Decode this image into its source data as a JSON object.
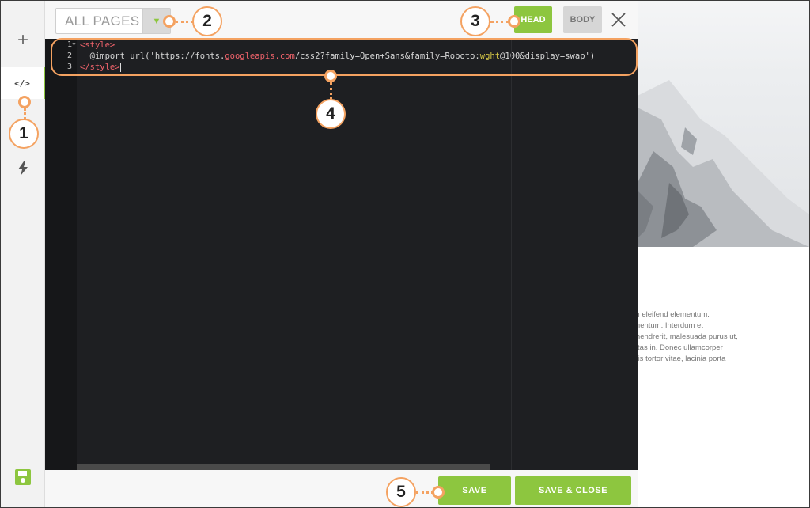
{
  "rail": {
    "add_icon": "plus-icon",
    "code_icon": "code-icon",
    "bolt_icon": "bolt-icon",
    "save_icon": "floppy-icon",
    "add_glyph": "+",
    "code_glyph": "</>"
  },
  "header": {
    "page_select_value": "ALL PAGES",
    "head_label": "HEAD",
    "body_label": "BODY",
    "close_icon": "close-icon"
  },
  "editor": {
    "line_numbers": [
      "1",
      "2",
      "3"
    ],
    "line1_tag": "<style>",
    "line2_prefix": "  @import url('https://fonts.",
    "line2_domain": "googleapis.com",
    "line2_mid": "/css2?family=Open+Sans&family=Roboto:",
    "line2_param": "wght",
    "line2_suffix": "@100&display=swap')",
    "line3_tag": "</style>"
  },
  "footer": {
    "save_label": "SAVE",
    "save_close_label": "SAVE & CLOSE"
  },
  "preview_text": [
    "din eleifend elementum.",
    "ementum. Interdum et",
    "e hendrerit, malesuada purus ut,",
    "estas in. Donec ullamcorper",
    "quis tortor vitae, lacinia porta"
  ],
  "callouts": [
    "1",
    "2",
    "3",
    "4",
    "5"
  ],
  "colors": {
    "accent": "#8dc63f",
    "callout": "#f4a261",
    "editor_bg": "#1e1f22",
    "tag": "#f0636b"
  }
}
